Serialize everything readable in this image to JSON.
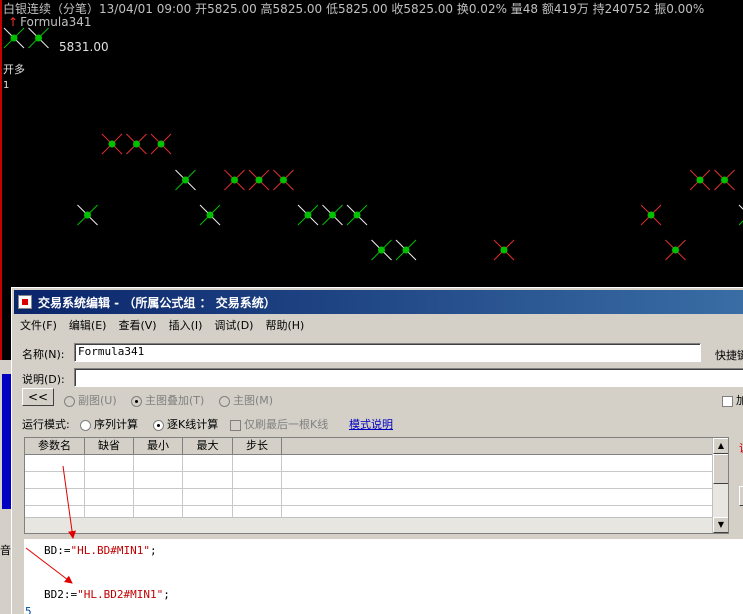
{
  "chart": {
    "info_line": "白银连续（分笔）13/04/01 09:00 开5825.00 高5825.00 低5825.00 收5825.00 换0.02% 量48 额419万 持240752 振0.00%",
    "formula_name": "Formula341",
    "price_label": "5831.00",
    "signal_label": "开多",
    "signal_count": "1",
    "colors": {
      "background": "#000000",
      "green_mark": "#00c000",
      "red_line": "#e03030",
      "white_line": "#f0f0f0"
    },
    "markers": [
      {
        "col": 0,
        "level": 0,
        "type": "green_white"
      },
      {
        "col": 1,
        "level": 0,
        "type": "green_white"
      },
      {
        "col": 3,
        "level": 4,
        "type": "green_white"
      },
      {
        "col": 4,
        "level": 2,
        "type": "red"
      },
      {
        "col": 5,
        "level": 2,
        "type": "red"
      },
      {
        "col": 6,
        "level": 2,
        "type": "red"
      },
      {
        "col": 7,
        "level": 3,
        "type": "green_white"
      },
      {
        "col": 8,
        "level": 4,
        "type": "green_white"
      },
      {
        "col": 9,
        "level": 3,
        "type": "red"
      },
      {
        "col": 10,
        "level": 3,
        "type": "red"
      },
      {
        "col": 11,
        "level": 3,
        "type": "red"
      },
      {
        "col": 12,
        "level": 4,
        "type": "green_white"
      },
      {
        "col": 13,
        "level": 4,
        "type": "green_white"
      },
      {
        "col": 14,
        "level": 4,
        "type": "green_white"
      },
      {
        "col": 15,
        "level": 5,
        "type": "green_white"
      },
      {
        "col": 16,
        "level": 5,
        "type": "green_white"
      },
      {
        "col": 20,
        "level": 5,
        "type": "red"
      },
      {
        "col": 27,
        "level": 5,
        "type": "red"
      },
      {
        "col": 26,
        "level": 4,
        "type": "red"
      },
      {
        "col": 28,
        "level": 3,
        "type": "red"
      },
      {
        "col": 29,
        "level": 3,
        "type": "red"
      },
      {
        "col": 30,
        "level": 4,
        "type": "green_white"
      }
    ]
  },
  "dialog": {
    "title": "交易系统编辑 - （所属公式组 ： 交易系统）",
    "menu": [
      "文件(F)",
      "编辑(E)",
      "查看(V)",
      "插入(I)",
      "调试(D)",
      "帮助(H)"
    ],
    "name_label": "名称(N):",
    "name_value": "Formula341",
    "desc_label": "说明(D):",
    "desc_value": "",
    "shortcut_label": "快捷键",
    "back_button": "<<",
    "view_options": [
      "副图(U)",
      "主图叠加(T)",
      "主图(M)"
    ],
    "run_mode_label": "运行模式:",
    "run_mode_options": [
      "序列计算",
      "逐K线计算"
    ],
    "run_mode_selected": "逐K线计算",
    "last_bar_only": "仅刷最后一根K线",
    "mode_help_link": "模式说明",
    "param_columns": [
      "参数名",
      "缺省",
      "最小",
      "最大",
      "步长"
    ],
    "right_red_label": "说",
    "right_check_label": "加",
    "code": [
      {
        "prefix": "BD:=",
        "string": "\"HL.BD#MIN1\"",
        "suffix": ";"
      },
      {
        "prefix": "BD2:=",
        "string": "\"HL.BD2#MIN1\"",
        "suffix": ";"
      }
    ],
    "line_number": "5"
  },
  "left_strip": {
    "char": "音"
  }
}
